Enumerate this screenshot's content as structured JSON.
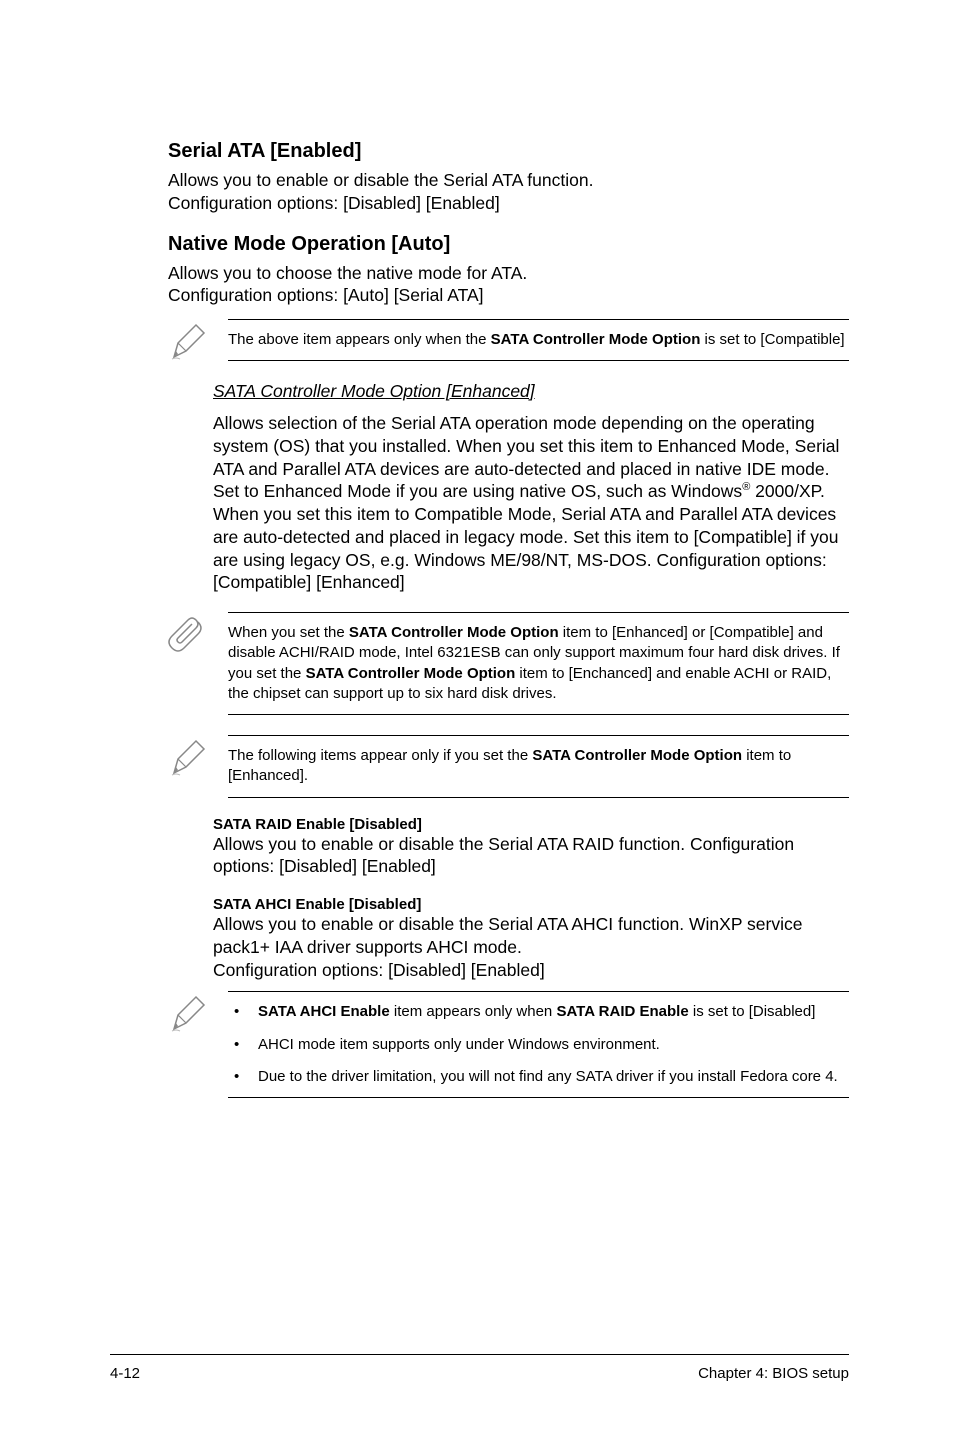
{
  "section1": {
    "title": "Serial ATA [Enabled]",
    "body": "Allows you to enable or disable the Serial ATA function.\nConfiguration options: [Disabled] [Enabled]"
  },
  "section2": {
    "title": "Native Mode Operation [Auto]",
    "body": "Allows you to choose the native mode for ATA.\nConfiguration options: [Auto] [Serial ATA]"
  },
  "note1": {
    "pre": "The above item appears only when the ",
    "bold": "SATA Controller Mode Option",
    "post": " is set to [Compatible]"
  },
  "section3": {
    "subheading": "SATA Controller Mode Option [Enhanced]",
    "body_pre": "Allows selection of the Serial ATA operation mode depending on the operating system (OS) that you installed. When you set this item to Enhanced Mode, Serial ATA and Parallel ATA devices are auto-detected and placed in native IDE mode. Set to Enhanced Mode if you are using native OS, such as Windows",
    "body_sup": "®",
    "body_post": " 2000/XP. When you set this item to Compatible Mode, Serial ATA and Parallel ATA devices are auto-detected and placed in legacy mode. Set this item to [Compatible] if you are using legacy OS, e.g. Windows ME/98/NT, MS-DOS. Configuration options: [Compatible] [Enhanced]"
  },
  "note2": {
    "pre": "When you set the ",
    "bold1": "SATA Controller Mode Option",
    "mid": " item to [Enhanced] or [Compatible] and disable ACHI/RAID mode, Intel 6321ESB can only support maximum four hard disk drives. If you set the ",
    "bold2": "SATA Controller Mode Option",
    "post": " item to [Enchanced] and enable ACHI or RAID, the chipset can support up to six hard disk drives."
  },
  "note3": {
    "pre": "The following items appear only if you set the ",
    "bold": "SATA Controller Mode Option",
    "post": " item to [Enhanced]."
  },
  "section4": {
    "title": "SATA RAID Enable [Disabled]",
    "body": "Allows you to enable or disable the Serial ATA RAID function. Configuration options: [Disabled] [Enabled]"
  },
  "section5": {
    "title": "SATA AHCI Enable [Disabled]",
    "body": "Allows you to enable or disable the Serial ATA AHCI function. WinXP service pack1+ IAA driver supports AHCI mode.\nConfiguration options: [Disabled] [Enabled]"
  },
  "note4": {
    "b1_bold1": "SATA AHCI Enable",
    "b1_mid": " item appears only when ",
    "b1_bold2": "SATA RAID Enable",
    "b1_post": " is set to [Disabled]",
    "b2": "AHCI mode item supports only under Windows environment.",
    "b3": "Due to the driver limitation, you will not find any SATA driver if you install Fedora core 4."
  },
  "footer": {
    "left": "4-12",
    "right": "Chapter 4: BIOS setup"
  }
}
